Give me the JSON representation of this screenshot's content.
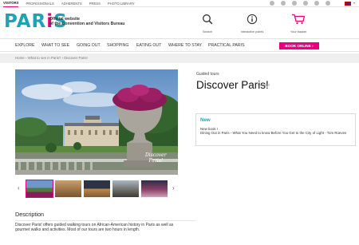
{
  "topbar": {
    "links": [
      "VISITORS",
      "PROFESSIONALS",
      "ADHERENTS",
      "PRESS",
      "PHOTO LIBRARY"
    ],
    "social_icons": [
      "facebook-icon",
      "twitter-icon",
      "youtube-icon",
      "pinterest-icon",
      "instagram-icon",
      "rss-icon"
    ],
    "language": "EN"
  },
  "header": {
    "logo": "PARIS",
    "tagline_line1": "Official website",
    "tagline_line2": "of the Convention and Visitors Bureau",
    "search_label": "Search",
    "points_label": "Interactive points",
    "basket_label": "Your basket",
    "accent": "#e6007e",
    "brand": "#1ea3b4"
  },
  "nav": {
    "items": [
      "EXPLORE",
      "WHAT TO SEE",
      "GOING OUT",
      "SHOPPING",
      "EATING OUT",
      "WHERE TO STAY",
      "PRACTICAL PARIS"
    ],
    "book_online": "BOOK ONLINE"
  },
  "breadcrumb": "Home › What to see in Paris? › Discover Paris!",
  "photo": {
    "caption_line1": "Discover",
    "caption_line2": "Paris!"
  },
  "offer": {
    "category": "Guided tours",
    "title": "Discover Paris!",
    "member_label": "Member",
    "new_title": "New",
    "new_line1": "New book !",
    "new_line2": "Dining Out in Paris - What You Need to know Before You Get to the City of Light - Tom Roeves"
  },
  "description": {
    "title": "Description",
    "text": "Discover Paris! offers guided walking tours on African-American history in Paris as well as gourmet walks and activities. Most of our tours are two hours in length."
  }
}
